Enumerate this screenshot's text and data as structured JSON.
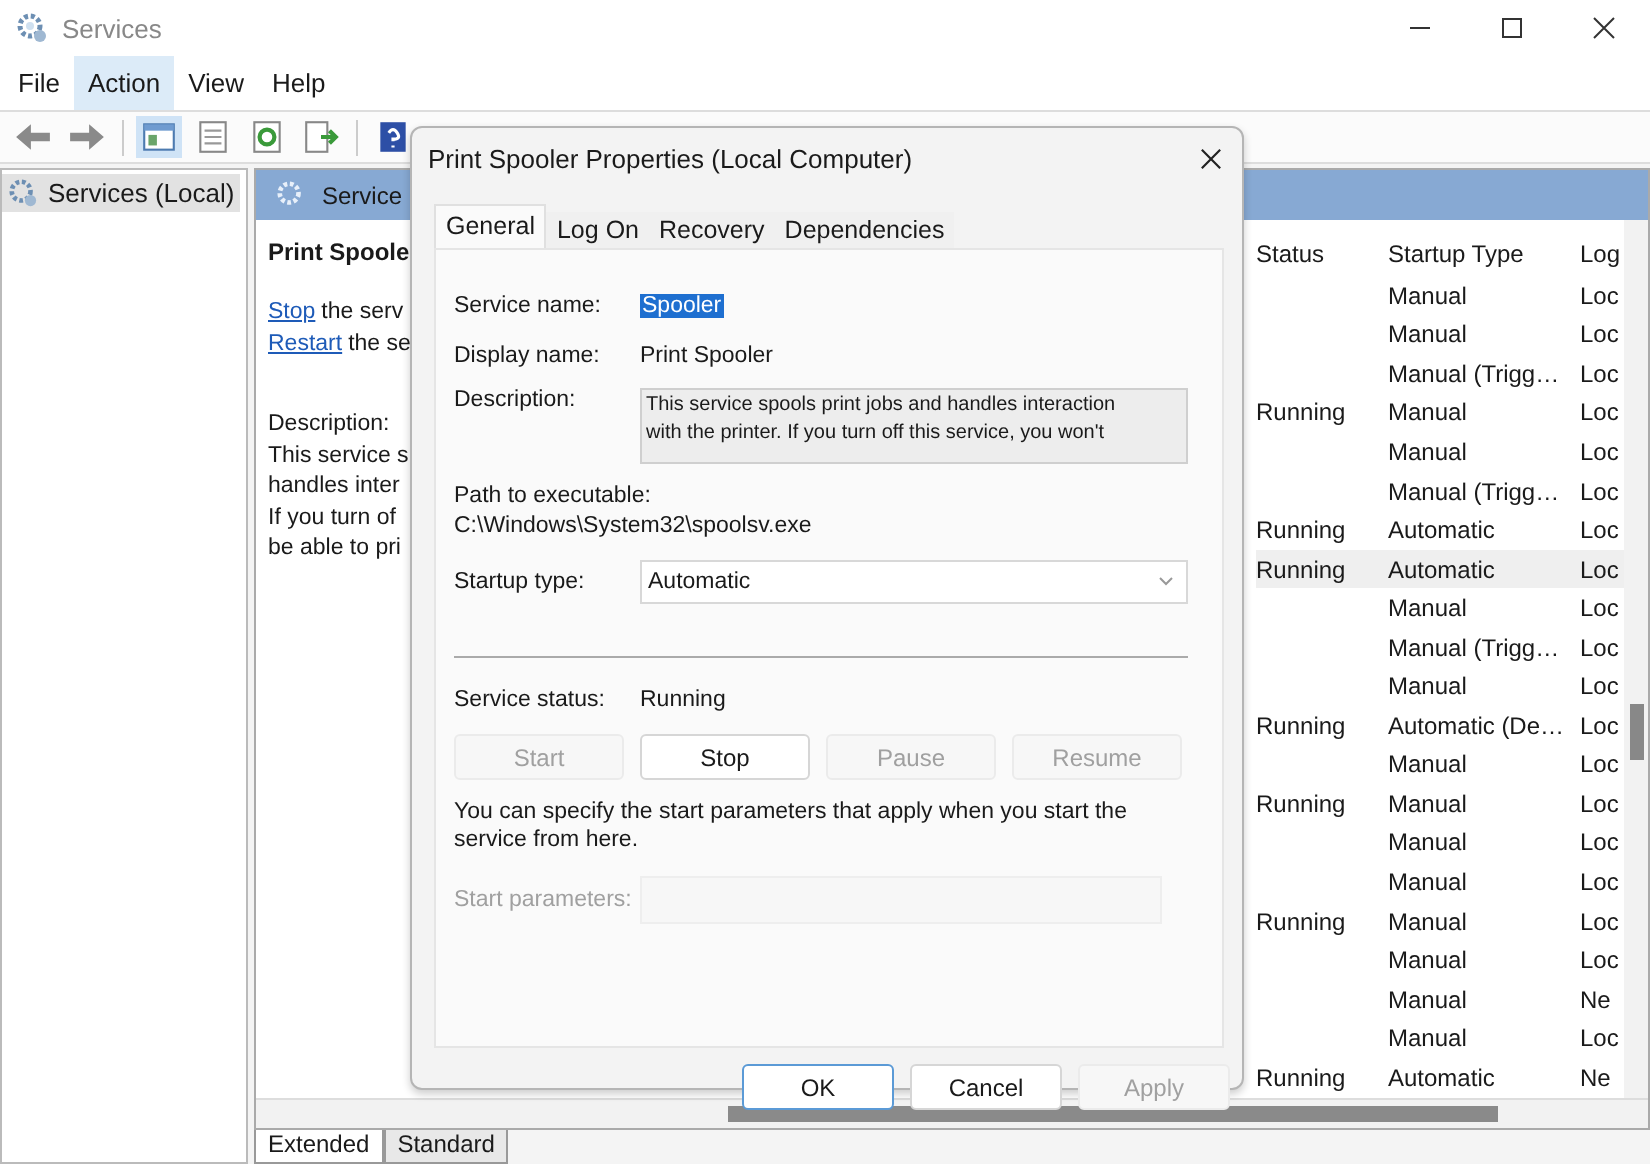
{
  "window": {
    "title": "Services"
  },
  "menu": [
    {
      "label": "File",
      "selected": false
    },
    {
      "label": "Action",
      "selected": true
    },
    {
      "label": "View",
      "selected": false
    },
    {
      "label": "Help",
      "selected": false
    }
  ],
  "tree": {
    "items": [
      {
        "label": "Services (Local)",
        "selected": true
      }
    ]
  },
  "panel": {
    "header": "Service",
    "detail": {
      "title": "Print Spoole",
      "actions": [
        {
          "link": "Stop",
          "rest": "the serv"
        },
        {
          "link": "Restart",
          "rest": "the se"
        }
      ],
      "description_label": "Description:",
      "description_lines": [
        "This service s",
        "handles inter",
        "If you turn of",
        "be able to pri"
      ]
    },
    "columns": [
      "Status",
      "Startup Type",
      "Log"
    ],
    "rows": [
      {
        "status": "",
        "startup_type": "Manual",
        "log_on": "Loc",
        "selected": false
      },
      {
        "status": "",
        "startup_type": "Manual",
        "log_on": "Loc",
        "selected": false
      },
      {
        "status": "",
        "startup_type": "Manual (Trigg…",
        "log_on": "Loc",
        "selected": false
      },
      {
        "status": "Running",
        "startup_type": "Manual",
        "log_on": "Loc",
        "selected": false
      },
      {
        "status": "",
        "startup_type": "Manual",
        "log_on": "Loc",
        "selected": false
      },
      {
        "status": "",
        "startup_type": "Manual (Trigg…",
        "log_on": "Loc",
        "selected": false
      },
      {
        "status": "Running",
        "startup_type": "Automatic",
        "log_on": "Loc",
        "selected": false
      },
      {
        "status": "Running",
        "startup_type": "Automatic",
        "log_on": "Loc",
        "selected": true
      },
      {
        "status": "",
        "startup_type": "Manual",
        "log_on": "Loc",
        "selected": false
      },
      {
        "status": "",
        "startup_type": "Manual (Trigg…",
        "log_on": "Loc",
        "selected": false
      },
      {
        "status": "",
        "startup_type": "Manual",
        "log_on": "Loc",
        "selected": false
      },
      {
        "status": "Running",
        "startup_type": "Automatic (De…",
        "log_on": "Loc",
        "selected": false
      },
      {
        "status": "",
        "startup_type": "Manual",
        "log_on": "Loc",
        "selected": false
      },
      {
        "status": "Running",
        "startup_type": "Manual",
        "log_on": "Loc",
        "selected": false
      },
      {
        "status": "",
        "startup_type": "Manual",
        "log_on": "Loc",
        "selected": false
      },
      {
        "status": "",
        "startup_type": "Manual",
        "log_on": "Loc",
        "selected": false
      },
      {
        "status": "Running",
        "startup_type": "Manual",
        "log_on": "Loc",
        "selected": false
      },
      {
        "status": "",
        "startup_type": "Manual",
        "log_on": "Loc",
        "selected": false
      },
      {
        "status": "",
        "startup_type": "Manual",
        "log_on": "Ne",
        "selected": false
      },
      {
        "status": "",
        "startup_type": "Manual",
        "log_on": "Loc",
        "selected": false
      },
      {
        "status": "Running",
        "startup_type": "Automatic",
        "log_on": "Ne",
        "selected": false
      }
    ],
    "view_tabs": [
      {
        "label": "Extended",
        "selected": true
      },
      {
        "label": "Standard",
        "selected": false
      }
    ]
  },
  "dialog": {
    "title": "Print Spooler Properties (Local Computer)",
    "tabs": [
      {
        "label": "General",
        "selected": true
      },
      {
        "label": "Log On",
        "selected": false
      },
      {
        "label": "Recovery",
        "selected": false
      },
      {
        "label": "Dependencies",
        "selected": false
      }
    ],
    "service_name": {
      "label": "Service name:",
      "value": "Spooler"
    },
    "display_name": {
      "label": "Display name:",
      "value": "Print Spooler"
    },
    "description": {
      "label": "Description:",
      "lines": [
        "This service spools print jobs and handles interaction",
        "with the printer.  If you turn off this service, you won't"
      ]
    },
    "path": {
      "label": "Path to executable:",
      "value": "C:\\Windows\\System32\\spoolsv.exe"
    },
    "startup_type": {
      "label": "Startup type:",
      "value": "Automatic"
    },
    "service_status": {
      "label": "Service status:",
      "value": "Running"
    },
    "control_buttons": [
      {
        "label": "Start",
        "disabled": true
      },
      {
        "label": "Stop",
        "disabled": false
      },
      {
        "label": "Pause",
        "disabled": true
      },
      {
        "label": "Resume",
        "disabled": true
      }
    ],
    "hint": "You can specify the start parameters that apply when you start the service from here.",
    "start_parameters": {
      "label": "Start parameters:",
      "disabled": true
    },
    "buttons": [
      {
        "label": "OK",
        "disabled": false,
        "default": true
      },
      {
        "label": "Cancel",
        "disabled": false,
        "default": false
      },
      {
        "label": "Apply",
        "disabled": true,
        "default": false
      }
    ]
  }
}
